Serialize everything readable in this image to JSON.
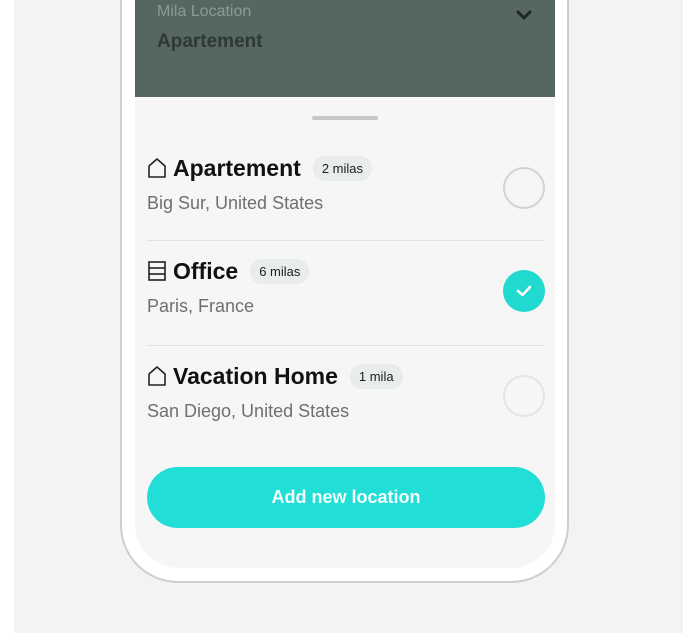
{
  "colors": {
    "accent": "#21ded6",
    "header_bg": "#566760",
    "sheet_bg": "#f6f6f6",
    "badge_bg": "#e9ecec"
  },
  "header": {
    "label": "Mila Location",
    "value": "Apartement",
    "chevron_icon": "chevron-down-icon"
  },
  "locations": [
    {
      "icon": "house-icon",
      "title": "Apartement",
      "distance": "2 milas",
      "subtitle": "Big Sur, United States",
      "selected": false
    },
    {
      "icon": "building-icon",
      "title": "Office",
      "distance": "6 milas",
      "subtitle": "Paris, France",
      "selected": true
    },
    {
      "icon": "house-icon",
      "title": "Vacation Home",
      "distance": "1 mila",
      "subtitle": "San Diego, United States",
      "selected": false
    }
  ],
  "add_button_label": "Add new location"
}
